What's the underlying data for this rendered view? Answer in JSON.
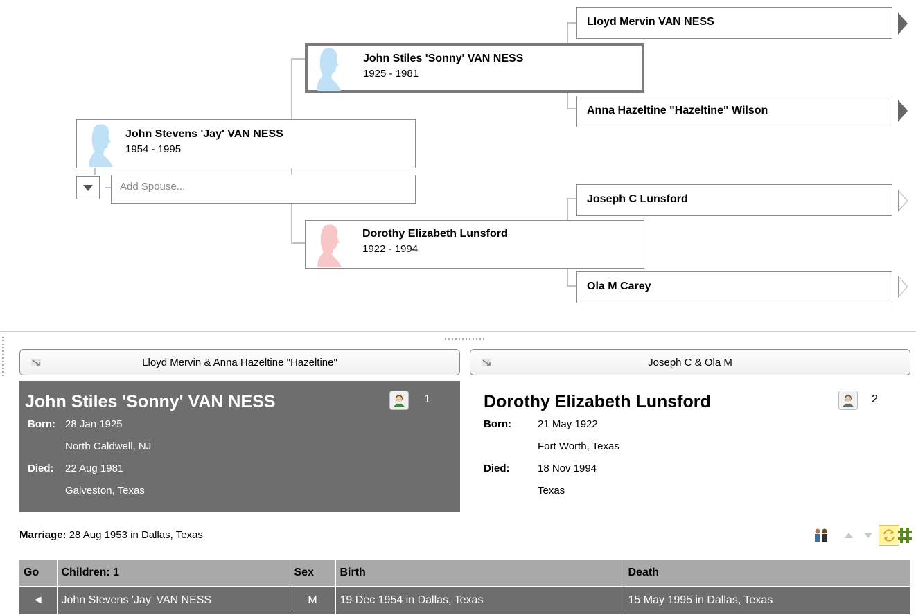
{
  "pedigree": {
    "root": {
      "name": "John Stevens 'Jay' VAN NESS",
      "dates": "1954 - 1995"
    },
    "add_spouse_placeholder": "Add Spouse...",
    "father": {
      "name": "John Stiles 'Sonny' VAN NESS",
      "dates": "1925 - 1981"
    },
    "mother": {
      "name": "Dorothy Elizabeth Lunsford",
      "dates": "1922 - 1994"
    },
    "paternal_grandfather": {
      "name": "Lloyd Mervin VAN NESS"
    },
    "paternal_grandmother": {
      "name": "Anna Hazeltine \"Hazeltine\" Wilson"
    },
    "maternal_grandfather": {
      "name": "Joseph C Lunsford"
    },
    "maternal_grandmother": {
      "name": "Ola M Carey"
    }
  },
  "family": {
    "father_parents_label": "Lloyd Mervin & Anna Hazeltine \"Hazeltine\"",
    "mother_parents_label": "Joseph C & Ola M",
    "husband": {
      "name": "John Stiles 'Sonny' VAN NESS",
      "born_label": "Born:",
      "born_date": "28 Jan 1925",
      "born_place": "North Caldwell, NJ",
      "died_label": "Died:",
      "died_date": "22 Aug 1981",
      "died_place": "Galveston, Texas",
      "media_count": "1"
    },
    "wife": {
      "name": "Dorothy Elizabeth Lunsford",
      "born_label": "Born:",
      "born_date": "21 May 1922",
      "born_place": "Fort Worth, Texas",
      "died_label": "Died:",
      "died_date": "18 Nov 1994",
      "died_place": "Texas",
      "media_count": "2"
    },
    "marriage_label": "Marriage:",
    "marriage_value": "28 Aug 1953 in Dallas, Texas"
  },
  "children_table": {
    "headers": {
      "go": "Go",
      "children": "Children: 1",
      "sex": "Sex",
      "birth": "Birth",
      "death": "Death"
    },
    "rows": [
      {
        "go": "◄",
        "name": "John Stevens 'Jay' VAN NESS",
        "sex": "M",
        "birth": "19 Dec 1954 in Dallas, Texas",
        "death": "15 May 1995 in Dallas, Texas"
      }
    ]
  },
  "colors": {
    "selected_panel": "#6e6e6e",
    "male_silhouette": "#bfe0f5",
    "female_silhouette": "#f7c6c6",
    "header_gray": "#a9a9a9",
    "accent_yellow": "#fff4a8",
    "grid_green": "#5a8a1e"
  }
}
